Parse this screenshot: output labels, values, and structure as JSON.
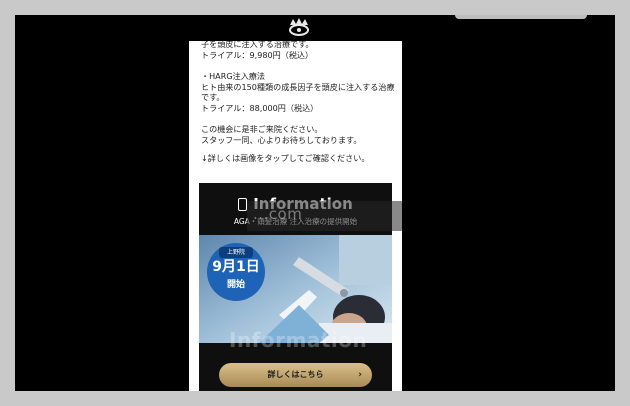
{
  "lines": [
    "子を頭皮に注入する治療です。",
    "トライアル：9,980円（税込）",
    "・HARG注入療法",
    "ヒト由来の150種類の成長因子を頭皮に注入する治療です。",
    "トライアル：88,000円（税込）",
    "この機会に是非ご来院ください。",
    "スタッフ一同、心よりお待ちしております。",
    "↓詳しくは画像をタップしてご確認ください。"
  ],
  "banner": {
    "title": "Information",
    "subtitle": "AGA・頭髪治療 注入治療の提供開始",
    "badge_tag": "上野院",
    "badge_date": "9月1日",
    "badge_start": "開始",
    "watermark": "Information",
    "cta_label": "詳しくはこちら",
    "cta_chevron": "›"
  },
  "overlay_watermark": "...com",
  "colors": {
    "stage": "#000000",
    "badge": "#1e63b5",
    "cta": "#c4a56f"
  },
  "icons": [
    "logo-crest-icon",
    "tablet-icon",
    "chevron-right-icon"
  ]
}
